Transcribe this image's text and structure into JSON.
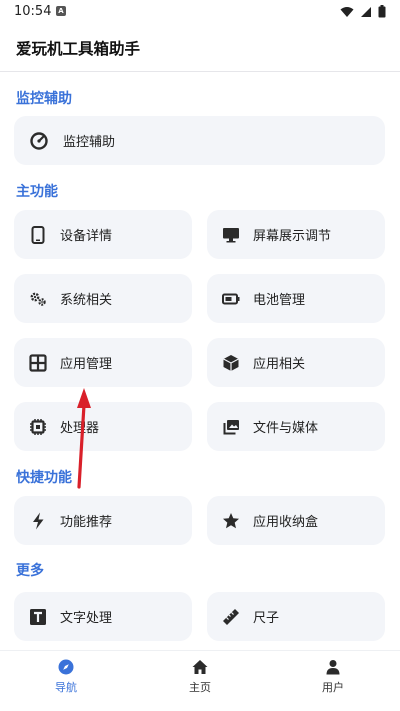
{
  "status_bar": {
    "time": "10:54",
    "notif_badge": "A"
  },
  "app": {
    "title": "爱玩机工具箱助手"
  },
  "sections": {
    "monitor": {
      "title": "监控辅助",
      "items": [
        {
          "label": "监控辅助",
          "icon": "speedometer-icon"
        }
      ]
    },
    "main": {
      "title": "主功能",
      "items": [
        {
          "label": "设备详情",
          "icon": "phone-icon"
        },
        {
          "label": "屏幕展示调节",
          "icon": "monitor-icon"
        },
        {
          "label": "系统相关",
          "icon": "gears-icon"
        },
        {
          "label": "电池管理",
          "icon": "battery-icon"
        },
        {
          "label": "应用管理",
          "icon": "grid-icon"
        },
        {
          "label": "应用相关",
          "icon": "cube-icon"
        },
        {
          "label": "处理器",
          "icon": "cpu-icon"
        },
        {
          "label": "文件与媒体",
          "icon": "photos-icon"
        }
      ]
    },
    "quick": {
      "title": "快捷功能",
      "items": [
        {
          "label": "功能推荐",
          "icon": "bolt-icon"
        },
        {
          "label": "应用收纳盒",
          "icon": "star-icon"
        }
      ]
    },
    "more": {
      "title": "更多",
      "items": [
        {
          "label": "文字处理",
          "icon": "text-icon"
        },
        {
          "label": "尺子",
          "icon": "ruler-icon"
        }
      ]
    }
  },
  "bottom_nav": [
    {
      "label": "导航",
      "icon": "compass-icon",
      "active": true
    },
    {
      "label": "主页",
      "icon": "home-icon",
      "active": false
    },
    {
      "label": "用户",
      "icon": "user-icon",
      "active": false
    }
  ],
  "colors": {
    "accent": "#3a72d9",
    "card_bg": "#f3f5f9",
    "icon": "#2b2b2b",
    "annotation_arrow": "#d9202a"
  }
}
